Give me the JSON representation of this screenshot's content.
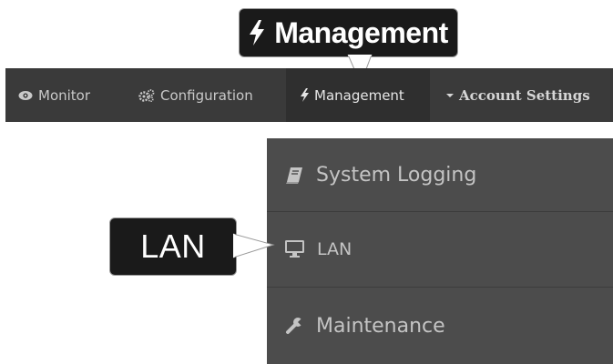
{
  "callouts": {
    "management": "Management",
    "lan": "LAN"
  },
  "nav": {
    "items": [
      {
        "label": "Monitor",
        "icon": "eye-icon"
      },
      {
        "label": "Configuration",
        "icon": "gears-icon"
      },
      {
        "label": "Management",
        "icon": "bolt-icon"
      },
      {
        "label": "Account Settings",
        "icon": "caret-down-icon"
      }
    ]
  },
  "dropdown": {
    "items": [
      {
        "label": "System Logging",
        "icon": "book-icon"
      },
      {
        "label": "LAN",
        "icon": "monitor-icon"
      },
      {
        "label": "Maintenance",
        "icon": "wrench-icon"
      }
    ]
  },
  "colors": {
    "navbar": "#3a3a3a",
    "dropdown": "#4c4c4c",
    "callout": "#1a1a1a"
  }
}
